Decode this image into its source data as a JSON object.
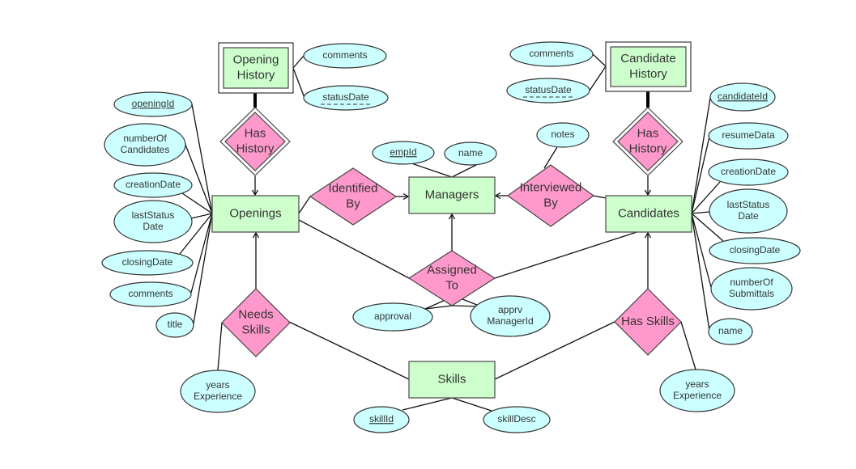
{
  "diagram": {
    "type": "entity-relationship",
    "colors": {
      "entity_fill": "#ccffcc",
      "relationship_fill": "#ff99cc",
      "attribute_fill": "#ccffff",
      "stroke": "#333333"
    },
    "entities": [
      {
        "id": "opening_history",
        "label": [
          "Opening",
          "History"
        ],
        "weak": true
      },
      {
        "id": "candidate_history",
        "label": [
          "Candidate",
          "History"
        ],
        "weak": true
      },
      {
        "id": "openings",
        "label": [
          "Openings"
        ],
        "weak": false
      },
      {
        "id": "managers",
        "label": [
          "Managers"
        ],
        "weak": false
      },
      {
        "id": "candidates",
        "label": [
          "Candidates"
        ],
        "weak": false
      },
      {
        "id": "skills",
        "label": [
          "Skills"
        ],
        "weak": false
      }
    ],
    "relationships": [
      {
        "id": "has_history_openings",
        "label": [
          "Has",
          "History"
        ],
        "identifying": true
      },
      {
        "id": "has_history_candidates",
        "label": [
          "Has",
          "History"
        ],
        "identifying": true
      },
      {
        "id": "identified_by",
        "label": [
          "Identified",
          "By"
        ],
        "identifying": false
      },
      {
        "id": "interviewed_by",
        "label": [
          "Interviewed",
          "By"
        ],
        "identifying": false
      },
      {
        "id": "assigned_to",
        "label": [
          "Assigned",
          "To"
        ],
        "identifying": false
      },
      {
        "id": "needs_skills",
        "label": [
          "Needs",
          "Skills"
        ],
        "identifying": false
      },
      {
        "id": "has_skills",
        "label": [
          "Has Skills"
        ],
        "identifying": false
      }
    ],
    "attributes": [
      {
        "id": "oh_comments",
        "owner": "opening_history",
        "label": [
          "comments"
        ],
        "key": "none"
      },
      {
        "id": "oh_statusdate",
        "owner": "opening_history",
        "label": [
          "statusDate"
        ],
        "key": "partial"
      },
      {
        "id": "ch_comments",
        "owner": "candidate_history",
        "label": [
          "comments"
        ],
        "key": "none"
      },
      {
        "id": "ch_statusdate",
        "owner": "candidate_history",
        "label": [
          "statusDate"
        ],
        "key": "partial"
      },
      {
        "id": "op_openingid",
        "owner": "openings",
        "label": [
          "openingId"
        ],
        "key": "primary"
      },
      {
        "id": "op_numcand",
        "owner": "openings",
        "label": [
          "numberOf",
          "Candidates"
        ],
        "key": "none"
      },
      {
        "id": "op_creation",
        "owner": "openings",
        "label": [
          "creationDate"
        ],
        "key": "none"
      },
      {
        "id": "op_laststatus",
        "owner": "openings",
        "label": [
          "lastStatus",
          "Date"
        ],
        "key": "none"
      },
      {
        "id": "op_closing",
        "owner": "openings",
        "label": [
          "closingDate"
        ],
        "key": "none"
      },
      {
        "id": "op_comments",
        "owner": "openings",
        "label": [
          "comments"
        ],
        "key": "none"
      },
      {
        "id": "op_title",
        "owner": "openings",
        "label": [
          "title"
        ],
        "key": "none"
      },
      {
        "id": "mg_empid",
        "owner": "managers",
        "label": [
          "empId"
        ],
        "key": "primary"
      },
      {
        "id": "mg_name",
        "owner": "managers",
        "label": [
          "name"
        ],
        "key": "none"
      },
      {
        "id": "ib_notes",
        "owner": "interviewed_by",
        "label": [
          "notes"
        ],
        "key": "none"
      },
      {
        "id": "at_approval",
        "owner": "assigned_to",
        "label": [
          "approval"
        ],
        "key": "none"
      },
      {
        "id": "at_apprv",
        "owner": "assigned_to",
        "label": [
          "apprv",
          "ManagerId"
        ],
        "key": "none"
      },
      {
        "id": "ca_candid",
        "owner": "candidates",
        "label": [
          "candidateId"
        ],
        "key": "primary"
      },
      {
        "id": "ca_resume",
        "owner": "candidates",
        "label": [
          "resumeData"
        ],
        "key": "none"
      },
      {
        "id": "ca_creation",
        "owner": "candidates",
        "label": [
          "creationDate"
        ],
        "key": "none"
      },
      {
        "id": "ca_laststatus",
        "owner": "candidates",
        "label": [
          "lastStatus",
          "Date"
        ],
        "key": "none"
      },
      {
        "id": "ca_closing",
        "owner": "candidates",
        "label": [
          "closingDate"
        ],
        "key": "none"
      },
      {
        "id": "ca_numsub",
        "owner": "candidates",
        "label": [
          "numberOf",
          "Submittals"
        ],
        "key": "none"
      },
      {
        "id": "ca_name",
        "owner": "candidates",
        "label": [
          "name"
        ],
        "key": "none"
      },
      {
        "id": "ns_years",
        "owner": "needs_skills",
        "label": [
          "years",
          "Experience"
        ],
        "key": "none"
      },
      {
        "id": "hs_years",
        "owner": "has_skills",
        "label": [
          "years",
          "Experience"
        ],
        "key": "none"
      },
      {
        "id": "sk_skillid",
        "owner": "skills",
        "label": [
          "skillId"
        ],
        "key": "primary"
      },
      {
        "id": "sk_desc",
        "owner": "skills",
        "label": [
          "skillDesc"
        ],
        "key": "none"
      }
    ],
    "connections": [
      {
        "from": "opening_history",
        "to": "has_history_openings",
        "style": "total"
      },
      {
        "from": "has_history_openings",
        "to": "openings",
        "style": "arrow"
      },
      {
        "from": "candidate_history",
        "to": "has_history_candidates",
        "style": "total"
      },
      {
        "from": "has_history_candidates",
        "to": "candidates",
        "style": "arrow"
      },
      {
        "from": "openings",
        "to": "identified_by",
        "style": "line"
      },
      {
        "from": "identified_by",
        "to": "managers",
        "style": "arrow"
      },
      {
        "from": "candidates",
        "to": "interviewed_by",
        "style": "line"
      },
      {
        "from": "interviewed_by",
        "to": "managers",
        "style": "arrow"
      },
      {
        "from": "openings",
        "to": "assigned_to",
        "style": "line"
      },
      {
        "from": "candidates",
        "to": "assigned_to",
        "style": "line"
      },
      {
        "from": "assigned_to",
        "to": "managers",
        "style": "arrow"
      },
      {
        "from": "needs_skills",
        "to": "openings",
        "style": "arrow"
      },
      {
        "from": "needs_skills",
        "to": "skills",
        "style": "line"
      },
      {
        "from": "has_skills",
        "to": "candidates",
        "style": "arrow"
      },
      {
        "from": "has_skills",
        "to": "skills",
        "style": "line"
      }
    ]
  }
}
